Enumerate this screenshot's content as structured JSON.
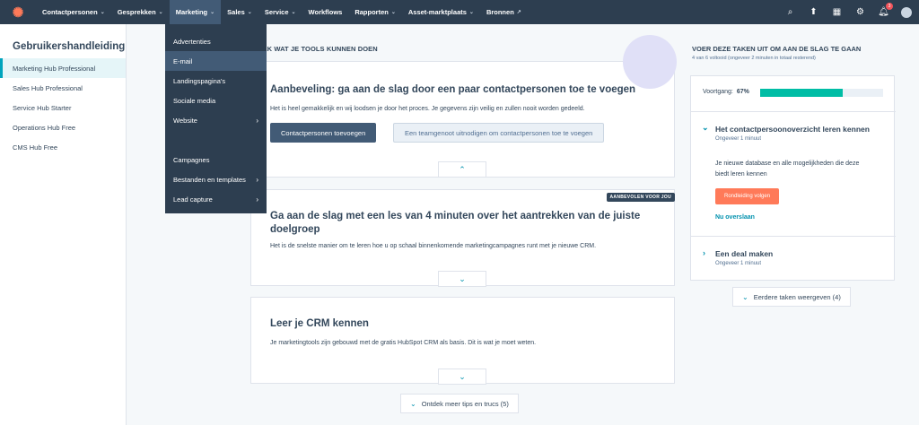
{
  "nav": {
    "logo": "hubspot-logo",
    "items": [
      {
        "label": "Contactpersonen",
        "has_caret": true
      },
      {
        "label": "Gesprekken",
        "has_caret": true
      },
      {
        "label": "Marketing",
        "has_caret": true,
        "active": true
      },
      {
        "label": "Sales",
        "has_caret": true
      },
      {
        "label": "Service",
        "has_caret": true
      },
      {
        "label": "Workflows",
        "has_caret": false
      },
      {
        "label": "Rapporten",
        "has_caret": true
      },
      {
        "label": "Asset-marktplaats",
        "has_caret": true
      },
      {
        "label": "Bronnen",
        "has_caret": false,
        "external": true
      }
    ],
    "notification_count": "3"
  },
  "dropdown": {
    "items": [
      {
        "label": "Advertenties",
        "submenu": false
      },
      {
        "label": "E-mail",
        "submenu": false,
        "active": true
      },
      {
        "label": "Landingspagina's",
        "submenu": false
      },
      {
        "label": "Sociale media",
        "submenu": false
      },
      {
        "label": "Website",
        "submenu": true
      },
      {
        "label": "Campagnes",
        "submenu": false
      },
      {
        "label": "Bestanden en templates",
        "submenu": true
      },
      {
        "label": "Lead capture",
        "submenu": true
      }
    ]
  },
  "sidebar": {
    "title": "Gebruikershandleiding",
    "items": [
      {
        "label": "Marketing Hub Professional",
        "active": true
      },
      {
        "label": "Sales Hub Professional"
      },
      {
        "label": "Service Hub Starter"
      },
      {
        "label": "Operations Hub Free"
      },
      {
        "label": "CMS Hub Free"
      }
    ]
  },
  "main": {
    "section_header": "DEK WAT JE TOOLS KUNNEN DOEN",
    "card1": {
      "title": "Aanbeveling: ga aan de slag door een paar contactpersonen toe te voegen",
      "desc": "Het is heel gemakkelijk en wij loodsen je door het proces. Je gegevens zijn veilig en zullen nooit worden gedeeld.",
      "primary_btn": "Contactpersonen toevoegen",
      "secondary_btn": "Een teamgenoot uitnodigen om contactpersonen toe te voegen"
    },
    "card2": {
      "badge": "AANBEVOLEN VOOR JOU",
      "title": "Ga aan de slag met een les van 4 minuten over het aantrekken van de juiste doelgroep",
      "desc": "Het is de snelste manier om te leren hoe u op schaal binnenkomende marketingcampagnes runt met je nieuwe CRM."
    },
    "card3": {
      "title": "Leer je CRM kennen",
      "desc": "Je marketingtools zijn gebouwd met de gratis HubSpot CRM als basis. Dit is wat je moet weten."
    },
    "more_tips": "Ontdek meer tips en trucs (5)"
  },
  "right": {
    "header": "VOER DEZE TAKEN UIT OM AAN DE SLAG TE GAAN",
    "subheader": "4 van 6 voltooid (ongeveer 2 minuten in totaal resterend)",
    "progress_label": "Voortgang:",
    "progress_value": "67%",
    "progress_fraction": 0.67,
    "task1": {
      "title": "Het contactpersoonoverzicht leren kennen",
      "sub": "Ongeveer 1 minuut",
      "desc": "Je nieuwe database en alle mogelijkheden die deze biedt leren kennen",
      "btn": "Rondleiding volgen",
      "skip": "Nu overslaan"
    },
    "task2": {
      "title": "Een deal maken",
      "sub": "Ongeveer 1 minuut"
    },
    "earlier_tasks": "Eerdere taken weergeven (4)"
  },
  "colors": {
    "nav_bg": "#2d3e50",
    "accent_teal": "#00bda5",
    "link": "#0091ae",
    "orange": "#ff7a59"
  }
}
